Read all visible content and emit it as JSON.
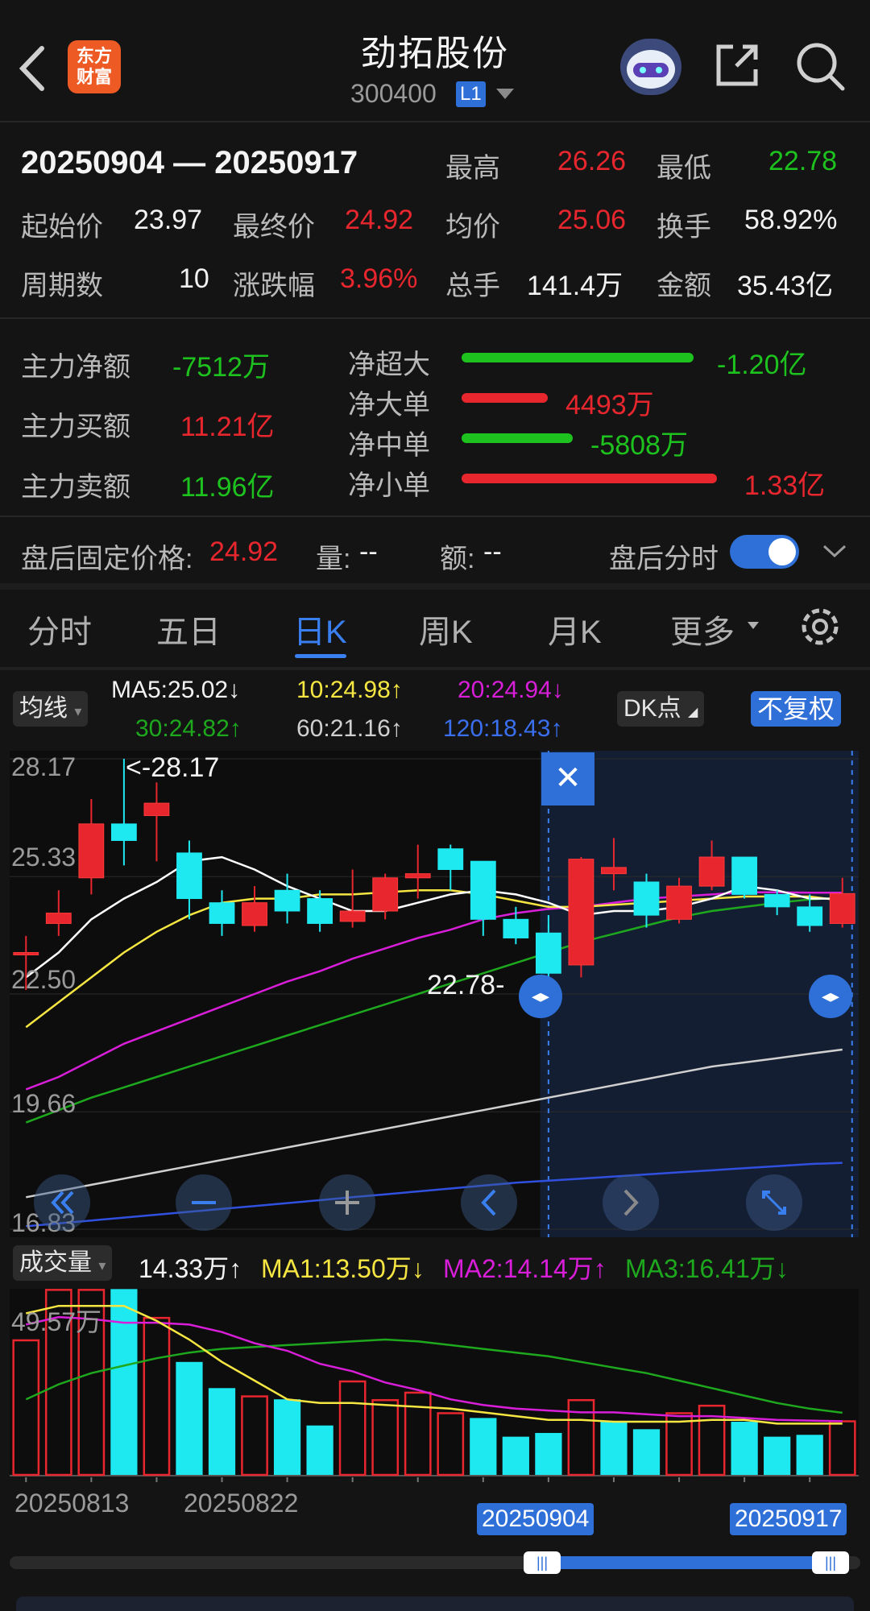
{
  "header": {
    "title": "劲拓股份",
    "code": "300400",
    "level": "L1",
    "logo_line1": "东方",
    "logo_line2": "财富"
  },
  "summary": {
    "date_range": "20250904 — 20250917",
    "high_label": "最高",
    "high": "26.26",
    "low_label": "最低",
    "low": "22.78",
    "open_label": "起始价",
    "open": "23.97",
    "close_label": "最终价",
    "close": "24.92",
    "avg_label": "均价",
    "avg": "25.06",
    "turnover_label": "换手",
    "turnover": "58.92%",
    "periods_label": "周期数",
    "periods": "10",
    "change_label": "涨跌幅",
    "change": "3.96%",
    "volume_label": "总手",
    "volume": "141.4万",
    "amount_label": "金额",
    "amount": "35.43亿"
  },
  "capital": {
    "net_label": "主力净额",
    "net": "-7512万",
    "buy_label": "主力买额",
    "buy": "11.21亿",
    "sell_label": "主力卖额",
    "sell": "11.96亿",
    "flows": [
      {
        "label": "净超大",
        "value": "-1.20亿",
        "color": "#1ec21e",
        "ratio": 1.0
      },
      {
        "label": "净大单",
        "value": "4493万",
        "color": "#e8262e",
        "ratio": 0.37
      },
      {
        "label": "净中单",
        "value": "-5808万",
        "color": "#1ec21e",
        "ratio": 0.48
      },
      {
        "label": "净小单",
        "value": "1.33亿",
        "color": "#e8262e",
        "ratio": 1.1
      }
    ]
  },
  "after_hours": {
    "price_label": "盘后固定价格:",
    "price": "24.92",
    "qty_label": "量:",
    "qty": "--",
    "amt_label": "额:",
    "amt": "--",
    "timeshare_label": "盘后分时",
    "toggle_on": true
  },
  "tabs": [
    "分时",
    "五日",
    "日K",
    "周K",
    "月K",
    "更多"
  ],
  "active_tab": "日K",
  "ma_legend": {
    "selector": "均线",
    "ma5": "MA5:25.02↓",
    "ma10": "10:24.98↑",
    "ma20": "20:24.94↓",
    "ma30": "30:24.82↑",
    "ma60": "60:21.16↑",
    "ma120": "120:18.43↑",
    "dk_button": "DK点",
    "adjust_button": "不复权"
  },
  "colors": {
    "up": "#e8262e",
    "down": "#1ee8f0",
    "ma5": "#ffffff",
    "ma10": "#f5e642",
    "ma20": "#d81ed8",
    "ma30": "#1ea81e",
    "ma60": "#d0d0d0",
    "ma120": "#3050e0",
    "accent": "#2f6fd8"
  },
  "volume_legend": {
    "selector": "成交量",
    "current": "14.33万↑",
    "ma1": "MA1:13.50万↓",
    "ma2": "MA2:14.14万↑",
    "ma3": "MA3:16.41万↓",
    "axis_max": "49.57万"
  },
  "chart_data": {
    "type": "candlestick",
    "y_ticks": [
      "28.17",
      "25.33",
      "22.50",
      "19.66",
      "16.83"
    ],
    "ylim": [
      16.83,
      28.17
    ],
    "max_annotation": "<-28.17",
    "min_annotation": "22.78-",
    "x_labels": [
      "20250813",
      "20250822",
      "20250904",
      "20250917"
    ],
    "selection": {
      "start": "20250904",
      "end": "20250917"
    },
    "candles": [
      {
        "o": 23.5,
        "c": 23.5,
        "h": 23.9,
        "l": 22.6
      },
      {
        "o": 24.2,
        "c": 24.45,
        "h": 25.0,
        "l": 23.9
      },
      {
        "o": 25.3,
        "c": 26.6,
        "h": 27.2,
        "l": 24.9
      },
      {
        "o": 26.6,
        "c": 26.2,
        "h": 28.17,
        "l": 25.6
      },
      {
        "o": 26.8,
        "c": 27.1,
        "h": 27.6,
        "l": 25.7
      },
      {
        "o": 25.9,
        "c": 24.8,
        "h": 26.2,
        "l": 24.3
      },
      {
        "o": 24.7,
        "c": 24.2,
        "h": 25.0,
        "l": 23.9
      },
      {
        "o": 24.15,
        "c": 24.7,
        "h": 25.1,
        "l": 24.0
      },
      {
        "o": 25.0,
        "c": 24.5,
        "h": 25.4,
        "l": 24.2
      },
      {
        "o": 24.8,
        "c": 24.2,
        "h": 25.0,
        "l": 24.0
      },
      {
        "o": 24.25,
        "c": 24.5,
        "h": 25.5,
        "l": 24.1
      },
      {
        "o": 24.5,
        "c": 25.3,
        "h": 25.4,
        "l": 24.3
      },
      {
        "o": 25.3,
        "c": 25.4,
        "h": 26.1,
        "l": 24.8
      },
      {
        "o": 26.0,
        "c": 25.5,
        "h": 26.1,
        "l": 25.0
      },
      {
        "o": 25.7,
        "c": 24.3,
        "h": 25.7,
        "l": 23.9
      },
      {
        "o": 24.3,
        "c": 23.85,
        "h": 24.6,
        "l": 23.7
      },
      {
        "o": 23.97,
        "c": 23.0,
        "h": 24.4,
        "l": 22.78
      },
      {
        "o": 23.2,
        "c": 25.75,
        "h": 25.8,
        "l": 22.9
      },
      {
        "o": 25.4,
        "c": 25.55,
        "h": 26.26,
        "l": 25.0
      },
      {
        "o": 25.2,
        "c": 24.4,
        "h": 25.4,
        "l": 24.1
      },
      {
        "o": 24.3,
        "c": 25.1,
        "h": 25.3,
        "l": 24.2
      },
      {
        "o": 25.1,
        "c": 25.8,
        "h": 26.2,
        "l": 25.0
      },
      {
        "o": 25.8,
        "c": 24.9,
        "h": 25.8,
        "l": 24.8
      },
      {
        "o": 24.9,
        "c": 24.6,
        "h": 25.0,
        "l": 24.4
      },
      {
        "o": 24.6,
        "c": 24.15,
        "h": 24.9,
        "l": 24.0
      },
      {
        "o": 24.2,
        "c": 24.92,
        "h": 25.3,
        "l": 24.1
      }
    ],
    "ma5": [
      22.9,
      23.5,
      24.3,
      24.8,
      25.2,
      25.7,
      25.8,
      25.5,
      25.1,
      24.8,
      24.5,
      24.5,
      24.7,
      24.9,
      25.0,
      24.9,
      24.7,
      24.4,
      24.5,
      24.5,
      24.6,
      24.8,
      25.1,
      25.0,
      24.8,
      24.8
    ],
    "ma10": [
      21.7,
      22.3,
      22.9,
      23.5,
      24.0,
      24.4,
      24.7,
      24.8,
      24.8,
      24.9,
      24.9,
      24.95,
      25.0,
      25.0,
      24.9,
      24.75,
      24.6,
      24.6,
      24.65,
      24.7,
      24.75,
      24.8,
      24.85,
      24.85,
      24.85,
      24.75
    ],
    "ma20": [
      20.2,
      20.5,
      20.9,
      21.3,
      21.6,
      21.9,
      22.2,
      22.5,
      22.8,
      23.05,
      23.35,
      23.6,
      23.85,
      24.05,
      24.3,
      24.45,
      24.55,
      24.6,
      24.7,
      24.8,
      24.85,
      24.9,
      24.95,
      24.95,
      24.94,
      24.94
    ],
    "ma30": [
      19.4,
      19.7,
      20.0,
      20.25,
      20.5,
      20.75,
      21.0,
      21.25,
      21.5,
      21.75,
      22.0,
      22.25,
      22.5,
      22.75,
      23.0,
      23.25,
      23.5,
      23.75,
      23.95,
      24.15,
      24.35,
      24.5,
      24.6,
      24.7,
      24.78,
      24.82
    ],
    "ma60": [
      17.6,
      17.75,
      17.9,
      18.05,
      18.2,
      18.35,
      18.5,
      18.65,
      18.8,
      18.95,
      19.1,
      19.25,
      19.4,
      19.55,
      19.7,
      19.85,
      20.0,
      20.15,
      20.3,
      20.45,
      20.6,
      20.75,
      20.85,
      20.95,
      21.06,
      21.16
    ],
    "ma120": [
      16.9,
      16.97,
      17.04,
      17.11,
      17.18,
      17.25,
      17.32,
      17.39,
      17.46,
      17.53,
      17.6,
      17.67,
      17.74,
      17.81,
      17.88,
      17.95,
      18.0,
      18.05,
      18.1,
      18.15,
      18.2,
      18.25,
      18.3,
      18.35,
      18.4,
      18.43
    ],
    "volume": {
      "ymax": 49.57,
      "bars": [
        {
          "v": 36,
          "up": true
        },
        {
          "v": 49.5,
          "up": true
        },
        {
          "v": 49.5,
          "up": true
        },
        {
          "v": 49.5,
          "up": false
        },
        {
          "v": 42,
          "up": true
        },
        {
          "v": 30,
          "up": false
        },
        {
          "v": 23,
          "up": false
        },
        {
          "v": 21,
          "up": true
        },
        {
          "v": 20,
          "up": false
        },
        {
          "v": 13,
          "up": false
        },
        {
          "v": 25,
          "up": true
        },
        {
          "v": 20,
          "up": true
        },
        {
          "v": 22,
          "up": true
        },
        {
          "v": 16.5,
          "up": true
        },
        {
          "v": 15,
          "up": false
        },
        {
          "v": 10,
          "up": false
        },
        {
          "v": 11,
          "up": false
        },
        {
          "v": 20,
          "up": true
        },
        {
          "v": 14,
          "up": false
        },
        {
          "v": 12,
          "up": false
        },
        {
          "v": 16.5,
          "up": true
        },
        {
          "v": 18.5,
          "up": true
        },
        {
          "v": 14,
          "up": false
        },
        {
          "v": 10,
          "up": false
        },
        {
          "v": 10.5,
          "up": false
        },
        {
          "v": 14.33,
          "up": true
        }
      ],
      "ma1": [
        43,
        45,
        45,
        45,
        41,
        36,
        30,
        25,
        20,
        19,
        19,
        18.5,
        18,
        17.5,
        16.5,
        15.5,
        14.5,
        14.5,
        14,
        14,
        14,
        14.5,
        14.5,
        13.5,
        13.5,
        13.5
      ],
      "ma2": [
        40,
        42,
        41.5,
        40.5,
        40.5,
        40,
        38,
        35,
        33,
        29.5,
        27.5,
        24.5,
        22.5,
        20,
        18.5,
        17.5,
        17,
        16.5,
        16.5,
        16,
        15.5,
        15.5,
        15,
        14.5,
        14.3,
        14.14
      ],
      "ma3": [
        20,
        24,
        27,
        29,
        31,
        32.5,
        33.5,
        34,
        34.5,
        35,
        35.5,
        36,
        35.5,
        34.5,
        33.5,
        32.5,
        31.5,
        30,
        28.5,
        27,
        25,
        23,
        21,
        19,
        17.5,
        16.41
      ]
    }
  }
}
